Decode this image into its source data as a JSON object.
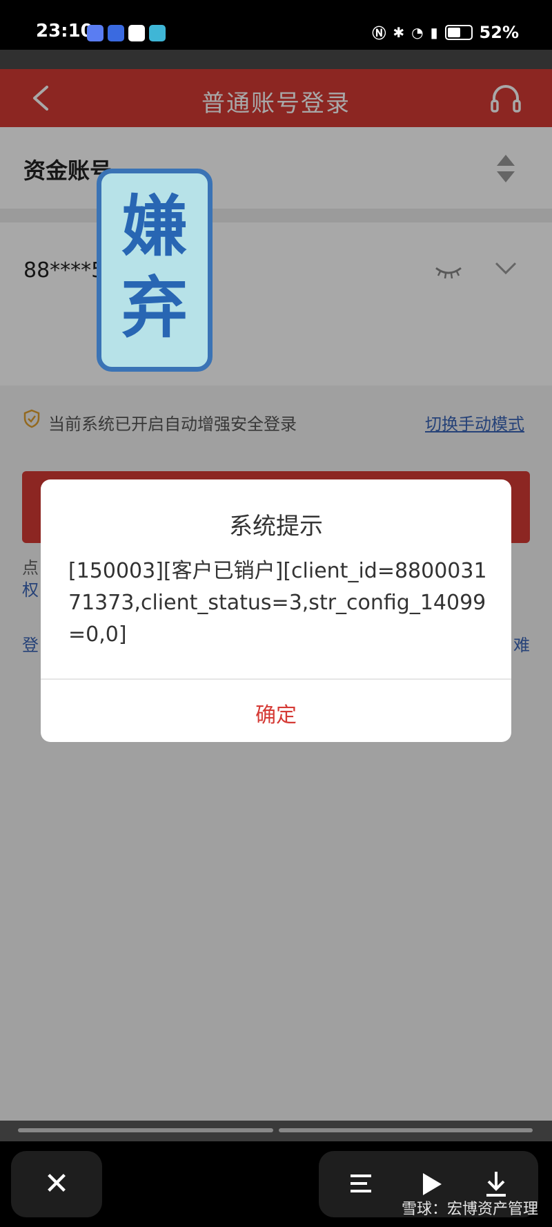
{
  "status_bar": {
    "time": "23:10",
    "battery": "52%",
    "battery_level": 0.52,
    "icons": [
      "nfc-icon",
      "bluetooth-icon",
      "wifi-icon",
      "5g-signal-icon"
    ],
    "app_icon_colors": [
      "#5a7df2",
      "#3a6ae0",
      "#ffffff",
      "#3fb6d6"
    ]
  },
  "header": {
    "title": "普通账号登录",
    "background": "#d53a35"
  },
  "form": {
    "account_type_label": "资金账号",
    "account_number": "88****5"
  },
  "security": {
    "text": "当前系统已开启自动增强安全登录",
    "link": "切换手动模式"
  },
  "hints": {
    "left_char_1": "点",
    "left_char_2": "权",
    "left_char_3": "登",
    "right_char": "难"
  },
  "stamp": {
    "text_line1": "嫌",
    "text_line2": "弃"
  },
  "dialog": {
    "title": "系统提示",
    "message": "[150003][客户已销户][client_id=880003171373,client_status=3,str_config_14099=0,0]",
    "ok": "确定"
  },
  "bottom": {
    "close": "✕",
    "watermark": "雪球：宏博资产管理"
  },
  "colors": {
    "accent_red": "#d53a35",
    "link_blue": "#3a64b6"
  }
}
